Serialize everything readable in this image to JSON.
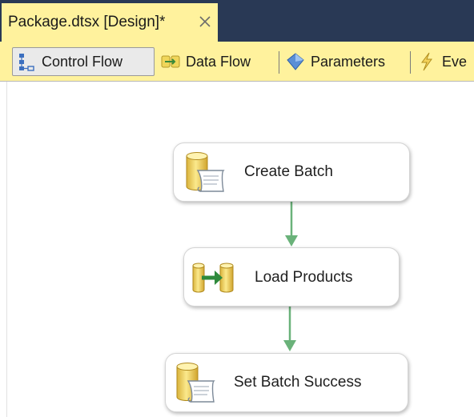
{
  "document_tab": {
    "title": "Package.dtsx [Design]*",
    "close_glyph": "✕"
  },
  "designer_tabs": [
    {
      "label": "Control Flow",
      "icon": "control-flow-icon",
      "active": true
    },
    {
      "label": "Data Flow",
      "icon": "data-flow-icon",
      "active": false
    },
    {
      "label": "Parameters",
      "icon": "parameters-icon",
      "active": false
    },
    {
      "label": "Eve",
      "icon": "event-handlers-icon",
      "active": false
    }
  ],
  "tasks": [
    {
      "label": "Create Batch",
      "icon": "execute-sql-task-icon"
    },
    {
      "label": "Load Products",
      "icon": "data-flow-task-icon"
    },
    {
      "label": "Set Batch Success",
      "icon": "execute-sql-task-icon"
    }
  ],
  "colors": {
    "tab_highlight": "#fff29d",
    "strip_background": "#293955",
    "connector_green": "#6ab27a"
  }
}
